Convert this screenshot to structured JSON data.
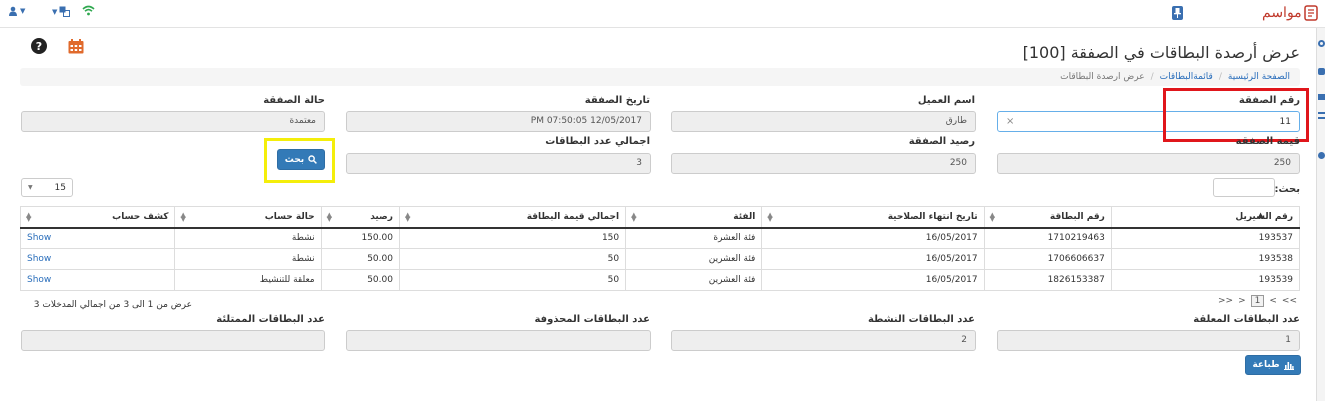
{
  "brand": {
    "name": "مواسم"
  },
  "page": {
    "title": "عرض أرصدة البطاقات في الصفقة [100]"
  },
  "breadcrumb": [
    "الصفحة الرئيسية",
    "قائمةالبطاقات",
    "عرض ارصدة البطاقات"
  ],
  "form": {
    "deal_number": {
      "label": "رقم الصفقة",
      "value": "11",
      "clear": "×"
    },
    "customer_name": {
      "label": "اسم العميل",
      "value": "طارق"
    },
    "deal_date": {
      "label": "تاريخ الصفقة",
      "value": "PM 07:50:05 12/05/2017"
    },
    "deal_status": {
      "label": "حالة الصفقة",
      "value": "معتمدة"
    },
    "deal_value": {
      "label": "قيمة الصفقة",
      "value": "250"
    },
    "deal_balance": {
      "label": "رصيد الصفقة",
      "value": "250"
    },
    "total_cards": {
      "label": "اجمالي عدد البطاقات",
      "value": "3"
    },
    "search_button": "بحث"
  },
  "table": {
    "page_size": "15",
    "search_label": "بحث:",
    "columns": [
      "رقم السيريل",
      "رقم البطاقة",
      "تاريخ انتهاء الصلاحية",
      "الفئة",
      "اجمالي قيمة البطاقة",
      "رصيد",
      "حالة حساب",
      "كشف حساب"
    ],
    "rows": [
      [
        "193537",
        "1710219463",
        "16/05/2017",
        "فئة العشرة",
        "150",
        "150.00",
        "نشطة",
        "Show"
      ],
      [
        "193538",
        "1706606637",
        "16/05/2017",
        "فئة العشرين",
        "50",
        "50.00",
        "نشطة",
        "Show"
      ],
      [
        "193539",
        "1826153387",
        "16/05/2017",
        "فئة العشرين",
        "50",
        "50.00",
        "معلقة للتنشيط",
        "Show"
      ]
    ],
    "pagination": {
      "first": "<<",
      "prev": "<",
      "current": "1",
      "next": ">",
      "last": ">>"
    },
    "info": "عرض من 1 الى 3 من اجمالي المدخلات 3"
  },
  "stats": {
    "suspended": {
      "label": "عدد البطاقات المعلقة",
      "value": "1"
    },
    "active": {
      "label": "عدد البطاقات النشطة",
      "value": "2"
    },
    "deleted": {
      "label": "عدد البطاقات المحذوفة",
      "value": ""
    },
    "used": {
      "label": "عدد البطاقات الممتلئة",
      "value": ""
    }
  },
  "print_button": "طباعة",
  "colors": {
    "accent": "#337ab7",
    "highlight_red": "#e0161b",
    "highlight_yellow": "#f4ee0a",
    "wifi": "#2fa84f",
    "calendar": "#e06a2c",
    "pin": "#3a6fb0"
  }
}
